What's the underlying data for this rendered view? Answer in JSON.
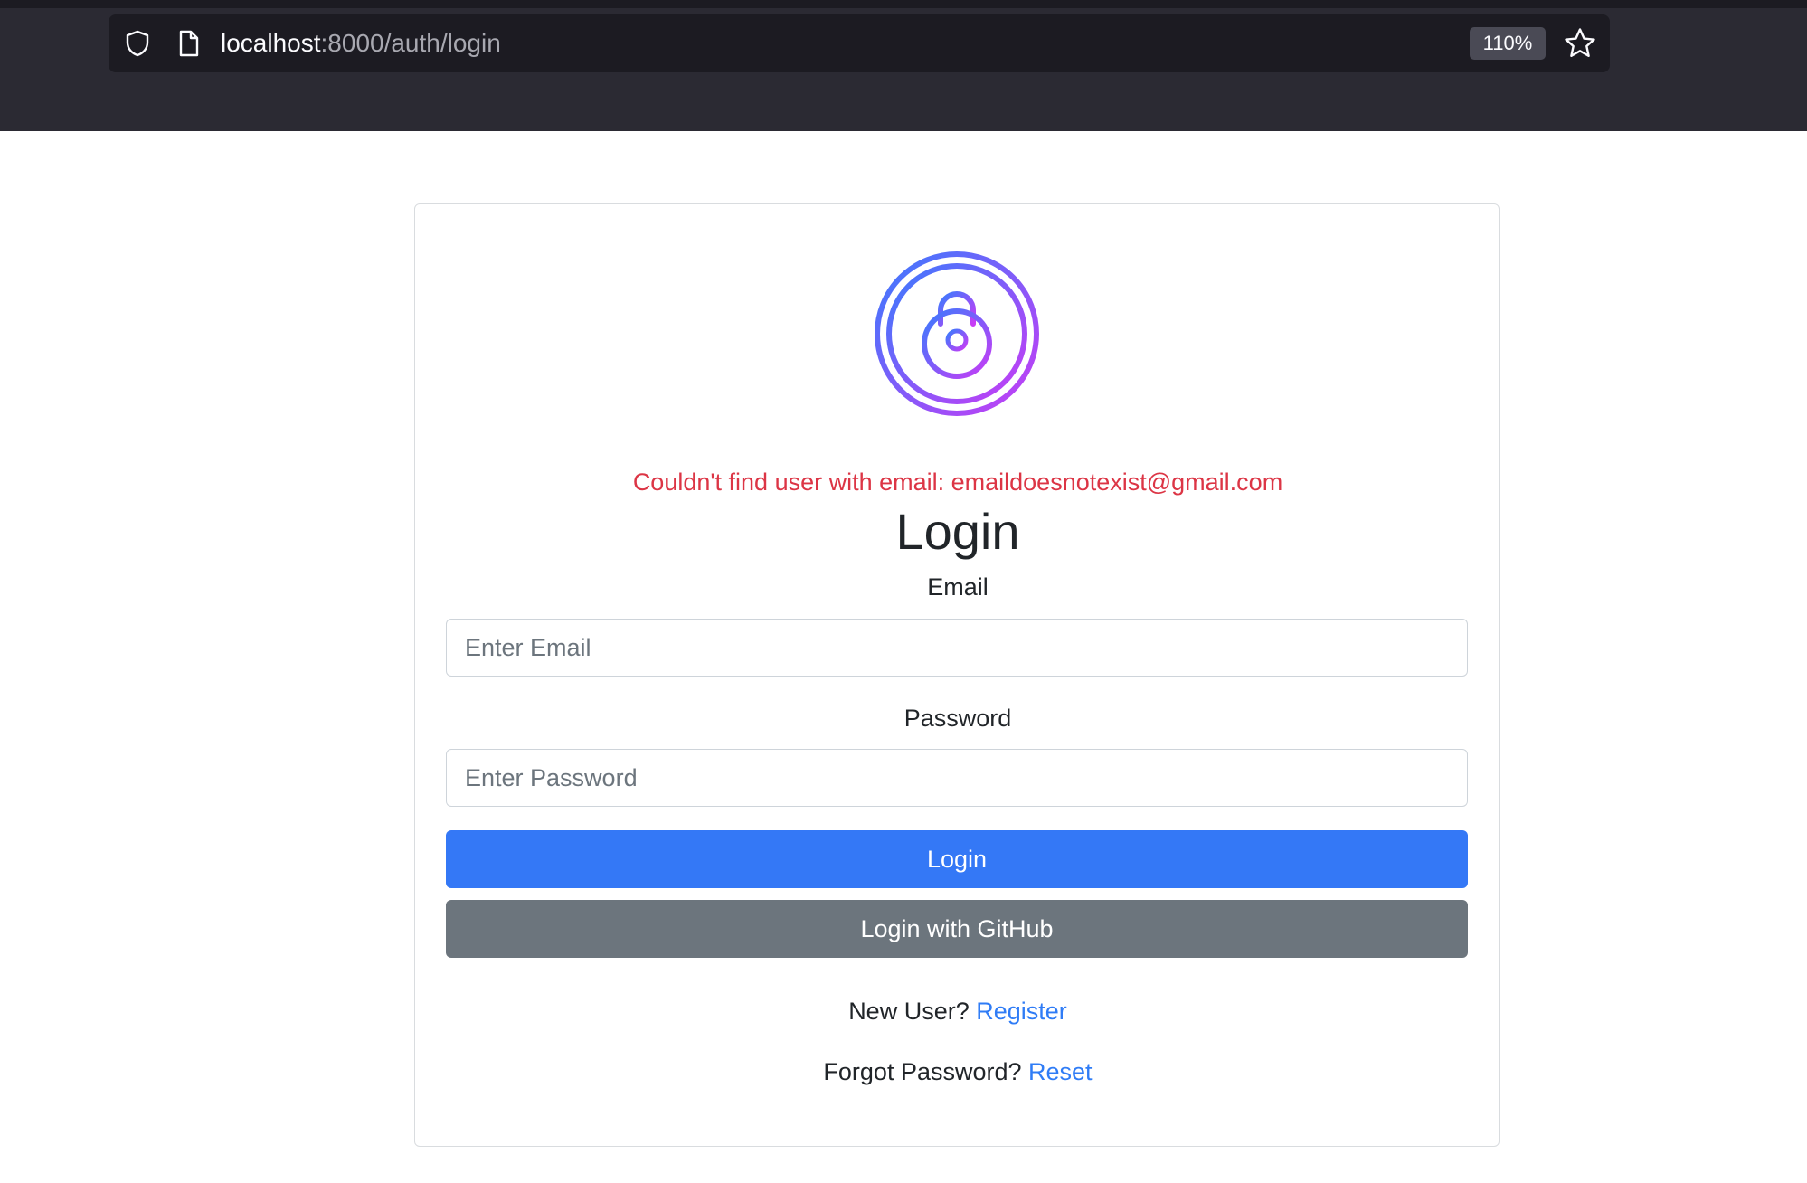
{
  "browser": {
    "url_host": "localhost",
    "url_path": ":8000/auth/login",
    "zoom": "110%"
  },
  "icons": {
    "shield": "shield-icon",
    "page": "page-icon",
    "star": "star-icon",
    "lock": "lock-icon"
  },
  "colors": {
    "primary": "#3478f6",
    "secondary": "#6c757d",
    "error": "#dc3545",
    "link": "#2f7cf6",
    "logo_gradient_start": "#3a7bfd",
    "logo_gradient_end": "#c83cf5"
  },
  "login": {
    "error_message": "Couldn't find user with email: emaildoesnotexist@gmail.com",
    "title": "Login",
    "email_label": "Email",
    "email_value": "",
    "email_placeholder": "Enter Email",
    "password_label": "Password",
    "password_value": "",
    "password_placeholder": "Enter Password",
    "login_button": "Login",
    "github_button": "Login with GitHub",
    "new_user_text": "New User?",
    "register_link": "Register",
    "forgot_text": "Forgot Password?",
    "reset_link": "Reset"
  }
}
